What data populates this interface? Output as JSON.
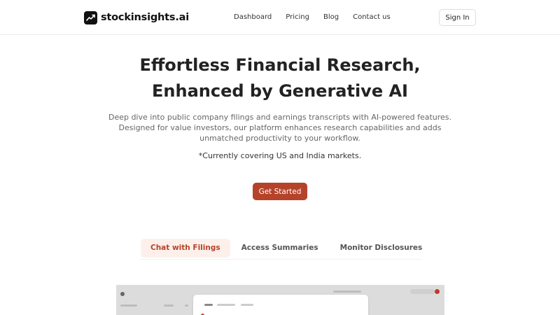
{
  "header": {
    "brand_name": "stockinsights.ai",
    "nav": [
      {
        "label": "Dashboard"
      },
      {
        "label": "Pricing"
      },
      {
        "label": "Blog"
      },
      {
        "label": "Contact us"
      }
    ],
    "signin_label": "Sign In"
  },
  "hero": {
    "title_line1": "Effortless Financial Research,",
    "title_line2": "Enhanced by Generative AI",
    "desc_line1": "Deep dive into public company filings and earnings transcripts with AI-powered features.",
    "desc_line2": "Designed for value investors, our platform enhances research capabilities and adds",
    "desc_line3": "unmatched productivity to your workflow.",
    "note": "*Currently covering US and India markets.",
    "cta_label": "Get Started"
  },
  "features": {
    "tabs": [
      {
        "label": "Chat with Filings",
        "active": true
      },
      {
        "label": "Access Summaries",
        "active": false
      },
      {
        "label": "Monitor Disclosures",
        "active": false
      }
    ]
  },
  "colors": {
    "accent": "#b5432a",
    "accent_light": "#fdf0ea",
    "text_dark": "#222222",
    "text_muted": "#666666"
  },
  "icons": {
    "brand": "trend-line-icon"
  }
}
